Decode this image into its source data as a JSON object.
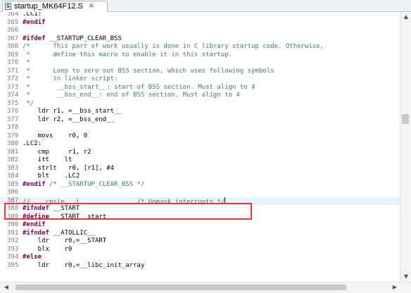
{
  "tab": {
    "title": "startup_MK64F12.S",
    "close_glyph": "✕",
    "file_icon": "S"
  },
  "editor": {
    "cursor_line": "387",
    "lines": [
      {
        "num": "364",
        "segments": [
          {
            "t": ".LC1:",
            "c": "plain"
          }
        ]
      },
      {
        "num": "365",
        "segments": [
          {
            "t": "#endif",
            "c": "kw"
          }
        ]
      },
      {
        "num": "366",
        "segments": []
      },
      {
        "num": "367",
        "segments": [
          {
            "t": "#ifdef",
            "c": "kw"
          },
          {
            "t": " __STARTUP_CLEAR_BSS",
            "c": "plain"
          }
        ]
      },
      {
        "num": "368",
        "segments": [
          {
            "t": "/*      This part of work usually is done in C library startup code. Otherwise,",
            "c": "cm"
          }
        ]
      },
      {
        "num": "369",
        "segments": [
          {
            "t": " *      define this macro to enable it in this startup.",
            "c": "cm"
          }
        ]
      },
      {
        "num": "370",
        "segments": [
          {
            "t": " *",
            "c": "cm"
          }
        ]
      },
      {
        "num": "371",
        "segments": [
          {
            "t": " *      Loop to zero out BSS section, which uses following symbols",
            "c": "cm"
          }
        ]
      },
      {
        "num": "372",
        "segments": [
          {
            "t": " *      in linker script:",
            "c": "cm"
          }
        ]
      },
      {
        "num": "373",
        "segments": [
          {
            "t": " *       __bss_start__: start of BSS section. Must align to 4",
            "c": "cm"
          }
        ]
      },
      {
        "num": "374",
        "segments": [
          {
            "t": " *       __bss_end__: end of BSS section. Must align to 4",
            "c": "cm"
          }
        ]
      },
      {
        "num": "375",
        "segments": [
          {
            "t": " */",
            "c": "cm"
          }
        ]
      },
      {
        "num": "376",
        "segments": [
          {
            "t": "    ldr r1, =__bss_start__",
            "c": "plain"
          }
        ]
      },
      {
        "num": "377",
        "segments": [
          {
            "t": "    ldr r2, =__bss_end__",
            "c": "plain"
          }
        ]
      },
      {
        "num": "378",
        "segments": []
      },
      {
        "num": "379",
        "segments": [
          {
            "t": "    movs    r0, 0",
            "c": "plain"
          }
        ]
      },
      {
        "num": "380",
        "segments": [
          {
            "t": ".LC2:",
            "c": "plain"
          }
        ]
      },
      {
        "num": "381",
        "segments": [
          {
            "t": "    cmp     r1, r2",
            "c": "plain"
          }
        ]
      },
      {
        "num": "382",
        "segments": [
          {
            "t": "    itt    lt",
            "c": "plain"
          }
        ]
      },
      {
        "num": "383",
        "segments": [
          {
            "t": "    strlt   r0, [r1], #4",
            "c": "plain"
          }
        ]
      },
      {
        "num": "384",
        "segments": [
          {
            "t": "    blt    .LC2",
            "c": "plain"
          }
        ]
      },
      {
        "num": "385",
        "segments": [
          {
            "t": "#endif",
            "c": "kw"
          },
          {
            "t": " /* __STARTUP_CLEAR_BSS */",
            "c": "cm"
          }
        ]
      },
      {
        "num": "386",
        "segments": []
      },
      {
        "num": "387",
        "segments": [
          {
            "t": "//    cpsie   i               /* Unmask interrupts */",
            "c": "cm"
          }
        ]
      },
      {
        "num": "388",
        "segments": [
          {
            "t": "#ifndef",
            "c": "kw"
          },
          {
            "t": " __START",
            "c": "plain"
          }
        ]
      },
      {
        "num": "389",
        "segments": [
          {
            "t": "#define",
            "c": "kw"
          },
          {
            "t": " __START _start",
            "c": "plain"
          }
        ]
      },
      {
        "num": "390",
        "segments": [
          {
            "t": "#endif",
            "c": "kw"
          }
        ]
      },
      {
        "num": "391",
        "segments": [
          {
            "t": "#ifndef",
            "c": "kw"
          },
          {
            "t": " __ATOLLIC__",
            "c": "plain"
          }
        ]
      },
      {
        "num": "392",
        "segments": [
          {
            "t": "    ldr    r0,=__START",
            "c": "plain"
          }
        ]
      },
      {
        "num": "393",
        "segments": [
          {
            "t": "    blx    r0",
            "c": "plain"
          }
        ]
      },
      {
        "num": "394",
        "segments": [
          {
            "t": "#else",
            "c": "kw"
          }
        ]
      },
      {
        "num": "395",
        "segments": [
          {
            "t": "    ldr    r0,=__libc_init_array",
            "c": "plain"
          }
        ]
      }
    ]
  },
  "scrollbars": {
    "up_arrow": "▲",
    "down_arrow": "▼",
    "left_arrow": "◀",
    "right_arrow": "▶"
  }
}
